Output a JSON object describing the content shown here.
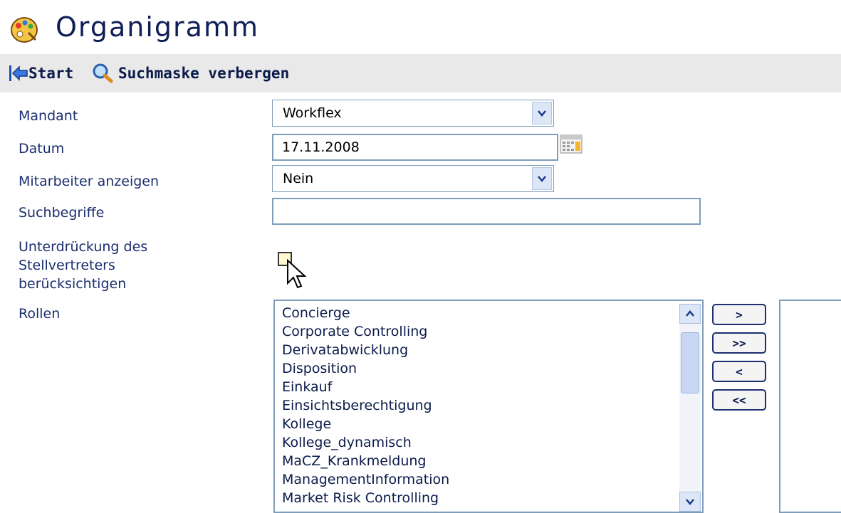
{
  "window": {
    "title": "Organigramm",
    "icon": "palette-icon"
  },
  "toolbar": {
    "start_label": "Start",
    "start_icon": "back-arrow-icon",
    "search_label": "Suchmaske verbergen",
    "search_icon": "magnifier-icon"
  },
  "form": {
    "mandant": {
      "label": "Mandant",
      "value": "Workflex"
    },
    "datum": {
      "label": "Datum",
      "value": "17.11.2008"
    },
    "mitarbeiter": {
      "label": "Mitarbeiter anzeigen",
      "value": "Nein"
    },
    "suchbegriffe": {
      "label": "Suchbegriffe",
      "value": ""
    },
    "unterdrueckung": {
      "label_lines": [
        "Unterdrückung des",
        "Stellvertreters",
        "berücksichtigen"
      ],
      "checked": false
    },
    "rollen": {
      "label": "Rollen",
      "items": [
        "Concierge",
        "Corporate Controlling",
        "Derivatabwicklung",
        "Disposition",
        "Einkauf",
        "Einsichtsberechtigung",
        "Kollege",
        "Kollege_dynamisch",
        "MaCZ_Krankmeldung",
        "ManagementInformation",
        "Market Risk Controlling"
      ]
    },
    "move_buttons": {
      "add": ">",
      "add_all": ">>",
      "remove": "<",
      "remove_all": "<<"
    }
  },
  "colors": {
    "label": "#1a2e6e",
    "title": "#0f1e54",
    "toolbar_bg": "#e9e9e9",
    "border": "#7f9db9"
  }
}
